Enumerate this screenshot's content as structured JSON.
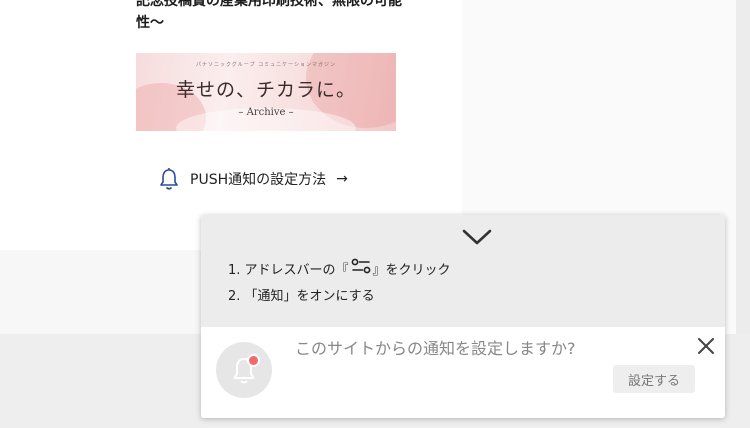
{
  "article": {
    "headline": "記念投稿賞の産業用印刷技術、無限の可能性〜",
    "banner": {
      "subtitle": "パナソニックグループ コミュニケーションマガジン",
      "title": "幸せの、チカラに。",
      "archive": "– Archive –"
    },
    "push_link": {
      "label": "PUSH通知の設定方法",
      "arrow": "→"
    }
  },
  "popup": {
    "step1_prefix": "1. アドレスバーの『",
    "step1_suffix": "』をクリック",
    "step2": "2. 「通知」をオンにする",
    "prompt": "このサイトからの通知を設定しますか?",
    "setup_label": "設定する",
    "close_glyph": "✕"
  },
  "colors": {
    "bell_icon": "#2b4a9a",
    "notification_dot": "#f06a6a",
    "popup_top_bg": "#ececec"
  }
}
